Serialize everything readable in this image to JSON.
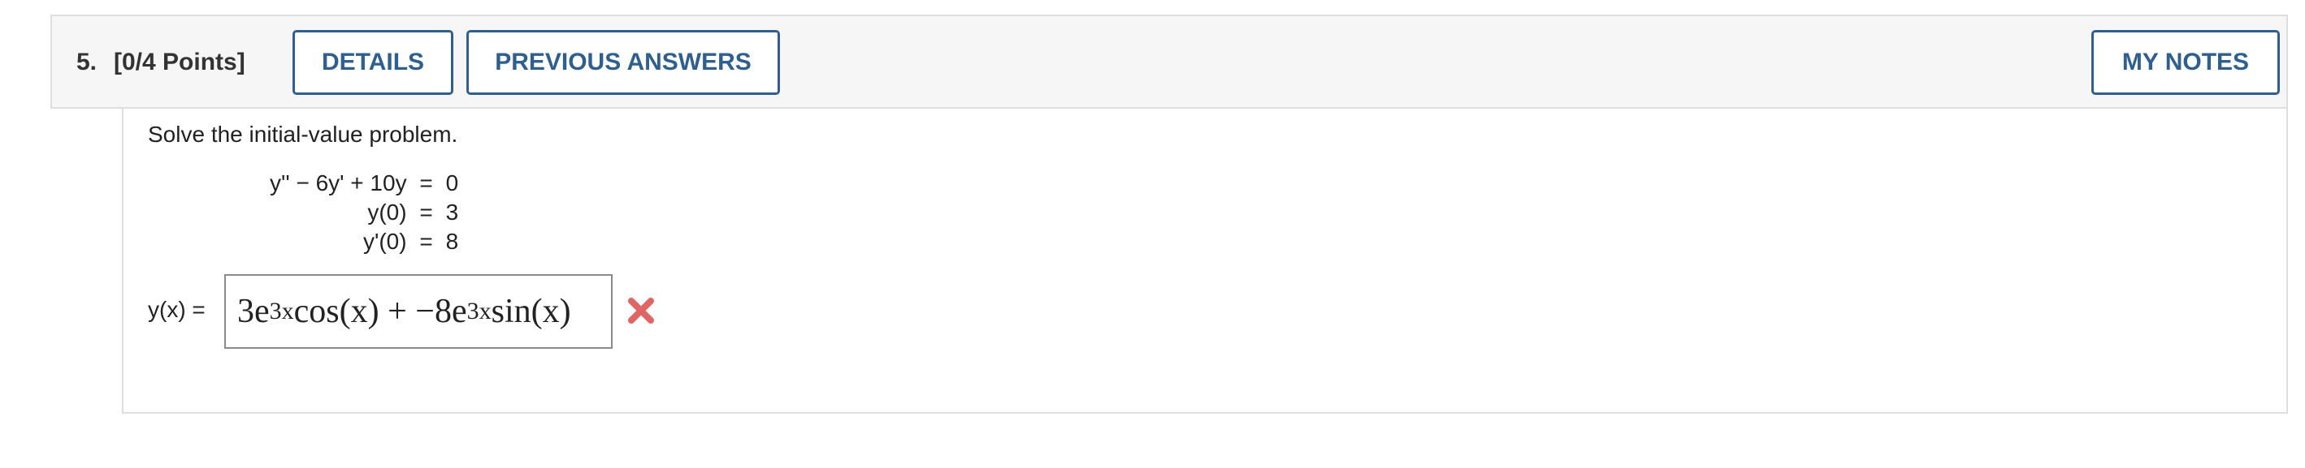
{
  "question": {
    "number": "5.",
    "points": "[0/4 Points]"
  },
  "header": {
    "details_label": "DETAILS",
    "previous_answers_label": "PREVIOUS ANSWERS",
    "my_notes_label": "MY NOTES"
  },
  "problem": {
    "instructions": "Solve the initial-value problem.",
    "equations": [
      {
        "left": "y'' − 6y' + 10y",
        "relation": "=",
        "right": "0"
      },
      {
        "left": "y(0)",
        "relation": "=",
        "right": "3"
      },
      {
        "left": "y'(0)",
        "relation": "=",
        "right": "8"
      }
    ]
  },
  "answer": {
    "label": "y(x) =",
    "parts": {
      "coef1": "3e",
      "exp1": "3x",
      "mid": "cos(x) + −8e",
      "exp2": "3x",
      "tail": "sin(x)"
    },
    "status_icon": "wrong-x-icon",
    "status_color": "#e06666"
  },
  "colors": {
    "accent": "#2f5f8e",
    "header_bg": "#f6f6f6",
    "border": "#dedede"
  }
}
